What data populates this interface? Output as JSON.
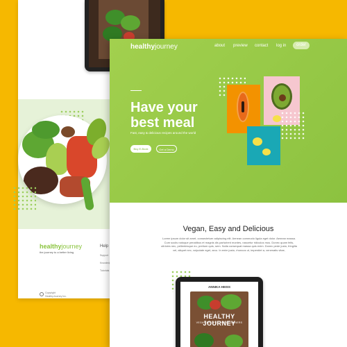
{
  "front": {
    "brand": {
      "bold": "healthy",
      "light": "journey"
    },
    "nav": [
      {
        "label": "about"
      },
      {
        "label": "preview"
      },
      {
        "label": "contact"
      },
      {
        "label": "log in"
      }
    ],
    "order_label": "order",
    "hero_title_line1": "Have your",
    "hero_title_line2": "best meal",
    "hero_subtitle": "Fast, easy & delicious recipes around the world",
    "cta_primary": "Buy E-Book",
    "cta_secondary": "Get a Demo",
    "section_title": "Vegan, Easy and Delicious",
    "section_text": "Lorem ipsum dolor sit amet, consectetuer adipiscing elit. Aenean commodo ligula eget dolor. Aenean massa. Cum sociis natoque penatibus et magnis dis parturient montes, nascetur ridiculus mus. Donec quam felis, ultricies nec, pellentesque eu, pretium quis, sem. Nulla consequat massa quis enim. Donec pede justo, fringilla vel, aliquet nec, vulputate eget, arcu. In enim justo, rhoncus ut, imperdiet a, venenatis vitae,",
    "book": {
      "author": "ANNIKA HEISS",
      "title": "HEALTHY JOURNEY",
      "subtitle": "VEGAN RECIPES FOR BEGINNERS"
    }
  },
  "back": {
    "brand": {
      "bold": "healthy",
      "light": "journey"
    },
    "tagline": "the journey to a better living",
    "help_heading": "Help",
    "help_links": [
      "Support",
      "Knowledge",
      "Tutorials"
    ],
    "copyright_line1": "Copyright",
    "copyright_line2": "HealthyJourney Inc."
  },
  "colors": {
    "background": "#f6b800",
    "hero_green": "#98c948",
    "accent_orange": "#f39200",
    "accent_pink": "#f6c7cf",
    "accent_teal": "#1aa8b5"
  }
}
